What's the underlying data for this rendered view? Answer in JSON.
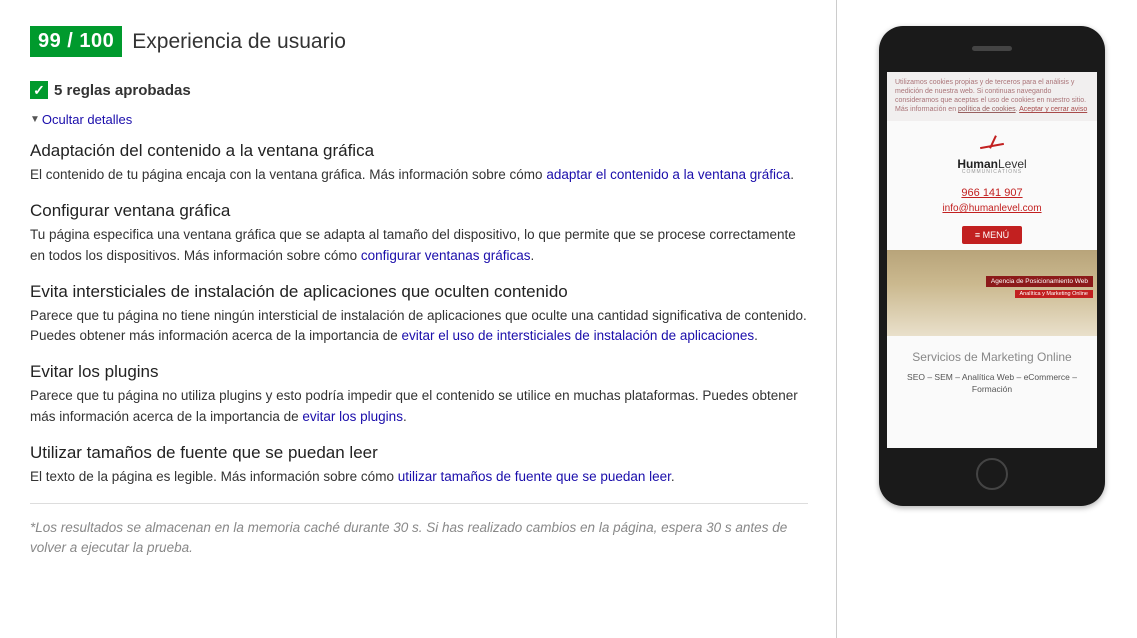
{
  "score": {
    "badge": "99 / 100",
    "title": "Experiencia de usuario"
  },
  "passed": {
    "count_label": "5 reglas aprobadas"
  },
  "toggle": {
    "label": "Ocultar detalles"
  },
  "rules": [
    {
      "title": "Adaptación del contenido a la ventana gráfica",
      "pre": "El contenido de tu página encaja con la ventana gráfica. Más información sobre cómo ",
      "link": "adaptar el contenido a la ventana gráfica",
      "post": "."
    },
    {
      "title": "Configurar ventana gráfica",
      "pre": "Tu página especifica una ventana gráfica que se adapta al tamaño del dispositivo, lo que permite que se procese correctamente en todos los dispositivos. Más información sobre cómo ",
      "link": "configurar ventanas gráficas",
      "post": "."
    },
    {
      "title": "Evita intersticiales de instalación de aplicaciones que oculten contenido",
      "pre": "Parece que tu página no tiene ningún intersticial de instalación de aplicaciones que oculte una cantidad significativa de contenido. Puedes obtener más información acerca de la importancia de ",
      "link": "evitar el uso de intersticiales de instalación de aplicaciones",
      "post": "."
    },
    {
      "title": "Evitar los plugins",
      "pre": "Parece que tu página no utiliza plugins y esto podría impedir que el contenido se utilice en muchas plataformas. Puedes obtener más información acerca de la importancia de ",
      "link": "evitar los plugins",
      "post": "."
    },
    {
      "title": "Utilizar tamaños de fuente que se puedan leer",
      "pre": "El texto de la página es legible. Más información sobre cómo ",
      "link": "utilizar tamaños de fuente que se puedan leer",
      "post": "."
    }
  ],
  "footnote": "*Los resultados se almacenan en la memoria caché durante 30 s. Si has realizado cambios en la página, espera 30 s antes de volver a ejecutar la prueba.",
  "preview": {
    "cookie_text": "Utilizamos cookies propias y de terceros para el análisis y medición de nuestra web. Si continuas navegando consideramos que aceptas el uso de cookies en nuestro sitio. Más información en ",
    "cookie_link": "política de cookies",
    "cookie_accept": "Aceptar y cerrar aviso",
    "brand1": "Human",
    "brand2": "Level",
    "brand_sub": "COMMUNICATIONS",
    "phone": "966 141 907",
    "email": "info@humanlevel.com",
    "menu": "≡ MENÚ",
    "hero_line1": "Agencia de Posicionamiento Web",
    "hero_line2": "Analítica y Marketing Online",
    "service_title": "Servicios de Marketing Online",
    "service_sub": "SEO – SEM – Analítica Web – eCommerce – Formación"
  }
}
